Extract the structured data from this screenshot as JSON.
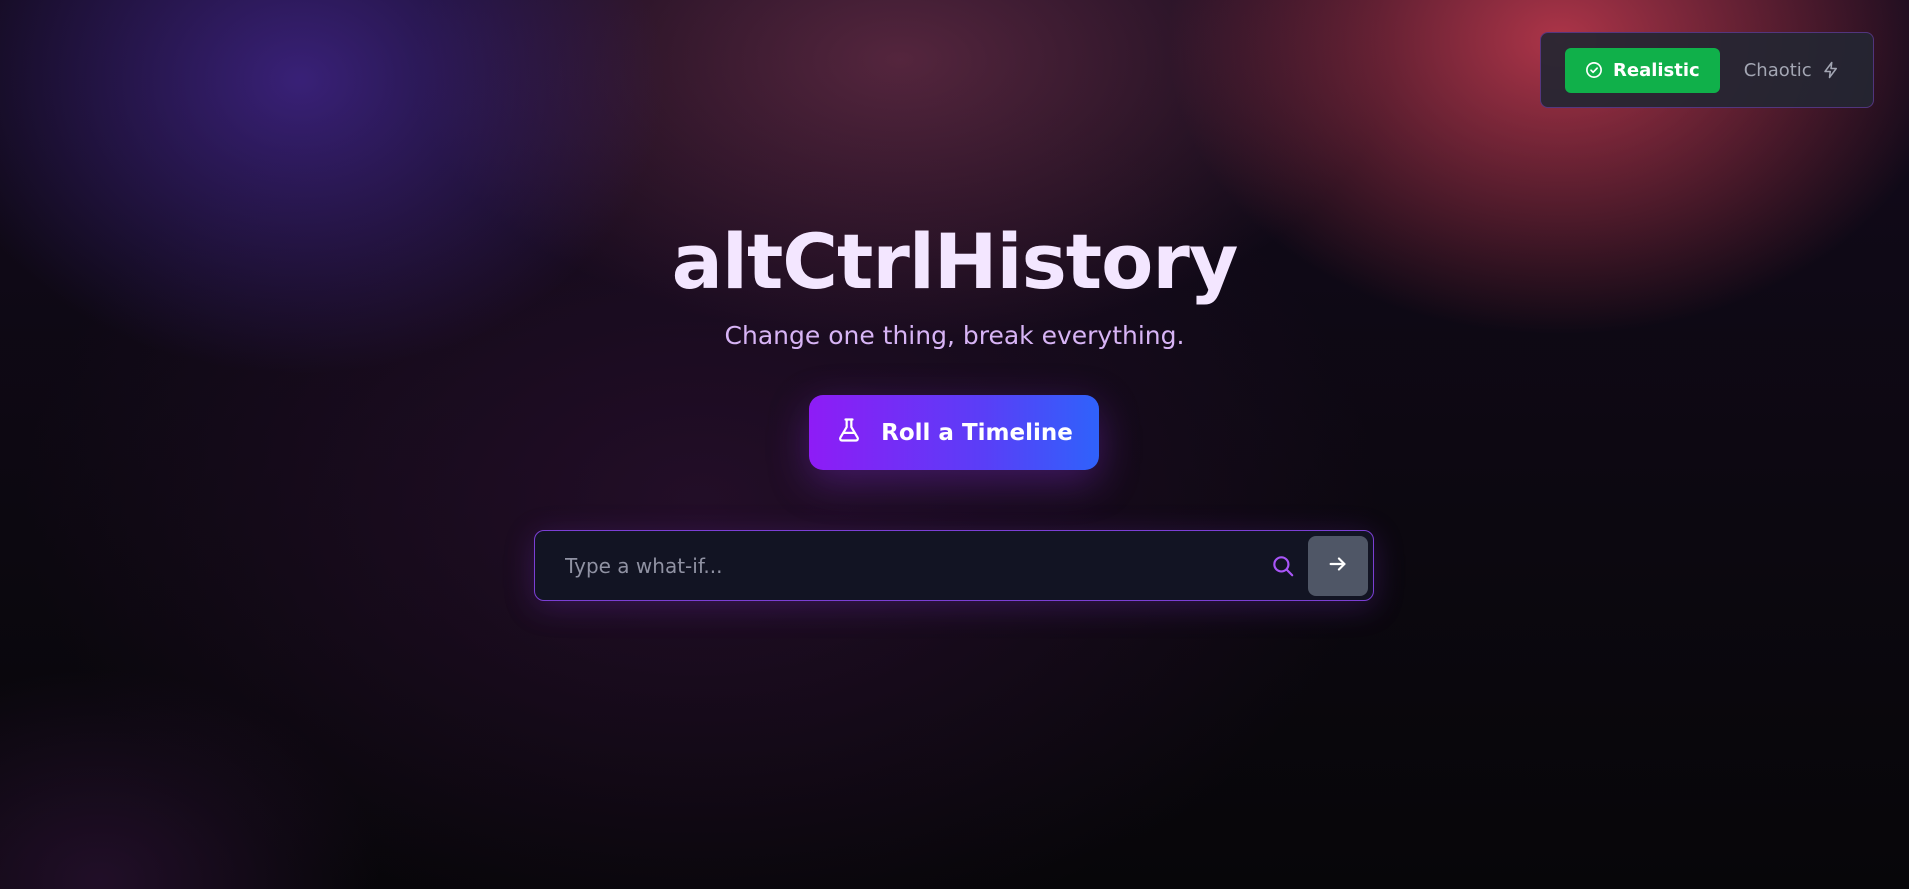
{
  "app": {
    "title": "altCtrlHistory",
    "subtitle": "Change one thing, break everything."
  },
  "mode_toggle": {
    "options": [
      {
        "label": "Realistic",
        "icon": "check-circle-icon",
        "active": true
      },
      {
        "label": "Chaotic",
        "icon": "lightning-icon",
        "active": false
      }
    ]
  },
  "actions": {
    "roll_label": "Roll a Timeline",
    "roll_icon": "flask-icon"
  },
  "search": {
    "placeholder": "Type a what-if...",
    "value": "",
    "icon": "search-icon",
    "submit_icon": "arrow-right-icon"
  },
  "colors": {
    "accent_green": "#10b04a",
    "accent_purple": "#8e1cf6",
    "accent_blue": "#2f62fb",
    "title_color": "#f3e6ff",
    "subtitle_color": "#d7b4f5"
  }
}
